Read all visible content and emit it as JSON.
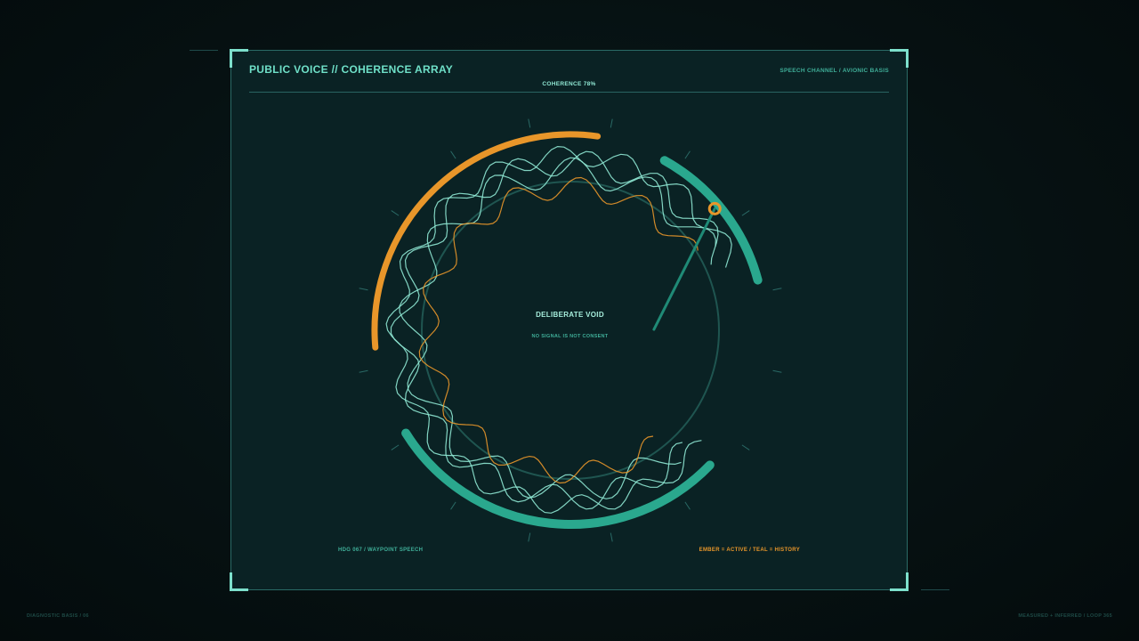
{
  "header": {
    "title": "PUBLIC VOICE // COHERENCE ARRAY",
    "channel": "SPEECH CHANNEL / AVIONIC BASIS",
    "coherence": "COHERENCE 78%"
  },
  "center": {
    "title": "DELIBERATE VOID",
    "subtitle": "NO SIGNAL IS NOT CONSENT"
  },
  "footer": {
    "left": "HDG 067 / WAYPOINT SPEECH",
    "right": "EMBER = ACTIVE / TEAL = HISTORY"
  },
  "page_footer": {
    "left": "DIAGNOSTIC BASIS / 06",
    "right": "MEASURED + INFERRED / LOOP 365"
  },
  "colors": {
    "ember": "#e8962a",
    "teal": "#2aa88e",
    "trace": "#8fe8d4",
    "background": "#0a2224"
  },
  "indicators": {
    "coherence_percent": 78,
    "heading_degrees": 67
  }
}
